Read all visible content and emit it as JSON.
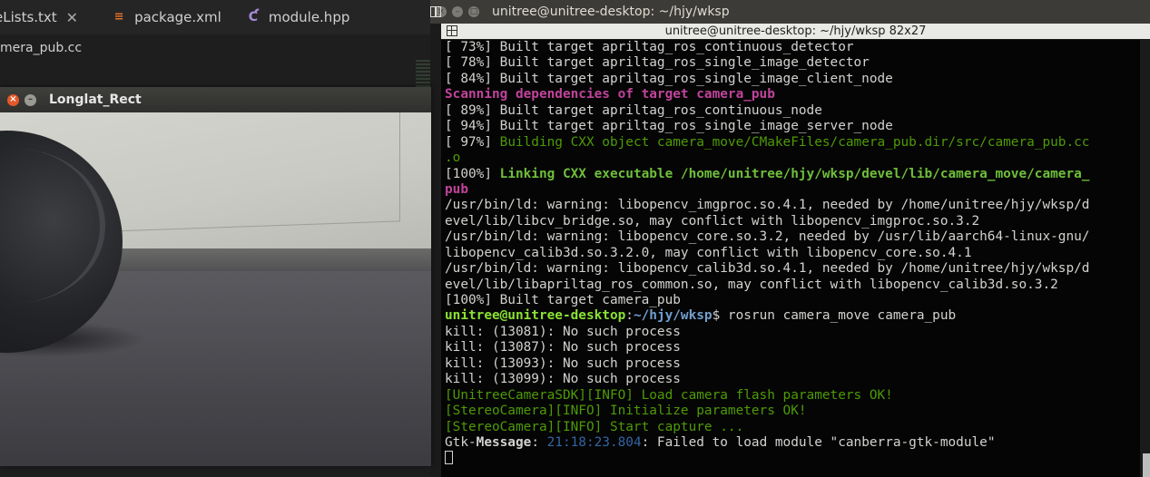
{
  "editor": {
    "tabs": [
      {
        "label": "eLists.txt",
        "icon": "text-file-icon",
        "closable": true
      },
      {
        "label": "package.xml",
        "icon": "rss-file-icon",
        "closable": false
      },
      {
        "label": "module.hpp",
        "icon": "cpp-file-icon",
        "closable": false
      }
    ],
    "close_glyph": "✕",
    "path": "mera_pub.cc"
  },
  "image_window": {
    "title": "Longlat_Rect",
    "close_glyph": "×",
    "min_glyph": "–"
  },
  "terminal": {
    "title": "unitree@unitree-desktop: ~/hjy/wksp",
    "tab_title": "unitree@unitree-desktop: ~/hjy/wksp 82x27",
    "lines": [
      {
        "style": "",
        "segments": [
          {
            "t": "[ 73%] Built target apriltag_ros_continuous_detector",
            "c": ""
          }
        ]
      },
      {
        "style": "",
        "segments": [
          {
            "t": "[ 78%] Built target apriltag_ros_single_image_detector",
            "c": ""
          }
        ]
      },
      {
        "style": "",
        "segments": [
          {
            "t": "[ 84%] Built target apriltag_ros_single_image_client_node",
            "c": ""
          }
        ]
      },
      {
        "style": "",
        "segments": [
          {
            "t": "Scanning dependencies of target camera_pub",
            "c": "c-scan"
          }
        ]
      },
      {
        "style": "",
        "segments": [
          {
            "t": "[ 89%] Built target apriltag_ros_continuous_node",
            "c": ""
          }
        ]
      },
      {
        "style": "",
        "segments": [
          {
            "t": "[ 94%] Built target apriltag_ros_single_image_server_node",
            "c": ""
          }
        ]
      },
      {
        "style": "",
        "segments": [
          {
            "t": "[ 97%] ",
            "c": ""
          },
          {
            "t": "Building CXX object camera_move/CMakeFiles/camera_pub.dir/src/camera_pub.cc",
            "c": "c-build"
          }
        ]
      },
      {
        "style": "",
        "segments": [
          {
            "t": ".o",
            "c": "c-build"
          }
        ]
      },
      {
        "style": "",
        "segments": [
          {
            "t": "[100%] ",
            "c": ""
          },
          {
            "t": "Linking CXX executable /home/unitree/hjy/wksp/devel/lib/camera_move/camera_",
            "c": "c-link"
          }
        ]
      },
      {
        "style": "",
        "segments": [
          {
            "t": "pub",
            "c": "c-scan"
          }
        ]
      },
      {
        "style": "",
        "segments": [
          {
            "t": "/usr/bin/ld: warning: libopencv_imgproc.so.4.1, needed by /home/unitree/hjy/wksp/d",
            "c": ""
          }
        ]
      },
      {
        "style": "",
        "segments": [
          {
            "t": "evel/lib/libcv_bridge.so, may conflict with libopencv_imgproc.so.3.2",
            "c": ""
          }
        ]
      },
      {
        "style": "",
        "segments": [
          {
            "t": "/usr/bin/ld: warning: libopencv_core.so.3.2, needed by /usr/lib/aarch64-linux-gnu/",
            "c": ""
          }
        ]
      },
      {
        "style": "",
        "segments": [
          {
            "t": "libopencv_calib3d.so.3.2.0, may conflict with libopencv_core.so.4.1",
            "c": ""
          }
        ]
      },
      {
        "style": "",
        "segments": [
          {
            "t": "/usr/bin/ld: warning: libopencv_calib3d.so.4.1, needed by /home/unitree/hjy/wksp/d",
            "c": ""
          }
        ]
      },
      {
        "style": "",
        "segments": [
          {
            "t": "evel/lib/libapriltag_ros_common.so, may conflict with libopencv_calib3d.so.3.2",
            "c": ""
          }
        ]
      },
      {
        "style": "",
        "segments": [
          {
            "t": "[100%] Built target camera_pub",
            "c": ""
          }
        ]
      },
      {
        "style": "",
        "segments": [
          {
            "t": "unitree@unitree-desktop",
            "c": "c-prompt"
          },
          {
            "t": ":",
            "c": ""
          },
          {
            "t": "~/hjy/wksp",
            "c": "c-path"
          },
          {
            "t": "$ rosrun camera_move camera_pub",
            "c": ""
          }
        ]
      },
      {
        "style": "",
        "segments": [
          {
            "t": "kill: (13081): No such process",
            "c": ""
          }
        ]
      },
      {
        "style": "",
        "segments": [
          {
            "t": "kill: (13087): No such process",
            "c": ""
          }
        ]
      },
      {
        "style": "",
        "segments": [
          {
            "t": "kill: (13093): No such process",
            "c": ""
          }
        ]
      },
      {
        "style": "",
        "segments": [
          {
            "t": "kill: (13099): No such process",
            "c": ""
          }
        ]
      },
      {
        "style": "",
        "segments": [
          {
            "t": "[UnitreeCameraSDK][INFO] Load camera flash parameters OK!",
            "c": "c-info"
          }
        ]
      },
      {
        "style": "",
        "segments": [
          {
            "t": "[StereoCamera][INFO] Initialize parameters OK!",
            "c": "c-info"
          }
        ]
      },
      {
        "style": "",
        "segments": [
          {
            "t": "[StereoCamera][INFO] Start capture ...",
            "c": "c-info"
          }
        ]
      },
      {
        "style": "",
        "segments": [
          {
            "t": "Gtk-",
            "c": ""
          },
          {
            "t": "Message",
            "c": "c-gtkmsg"
          },
          {
            "t": ": ",
            "c": ""
          },
          {
            "t": "21:18:23.804",
            "c": "c-time"
          },
          {
            "t": ": Failed to load module \"canberra-gtk-module\"",
            "c": ""
          }
        ]
      }
    ]
  }
}
